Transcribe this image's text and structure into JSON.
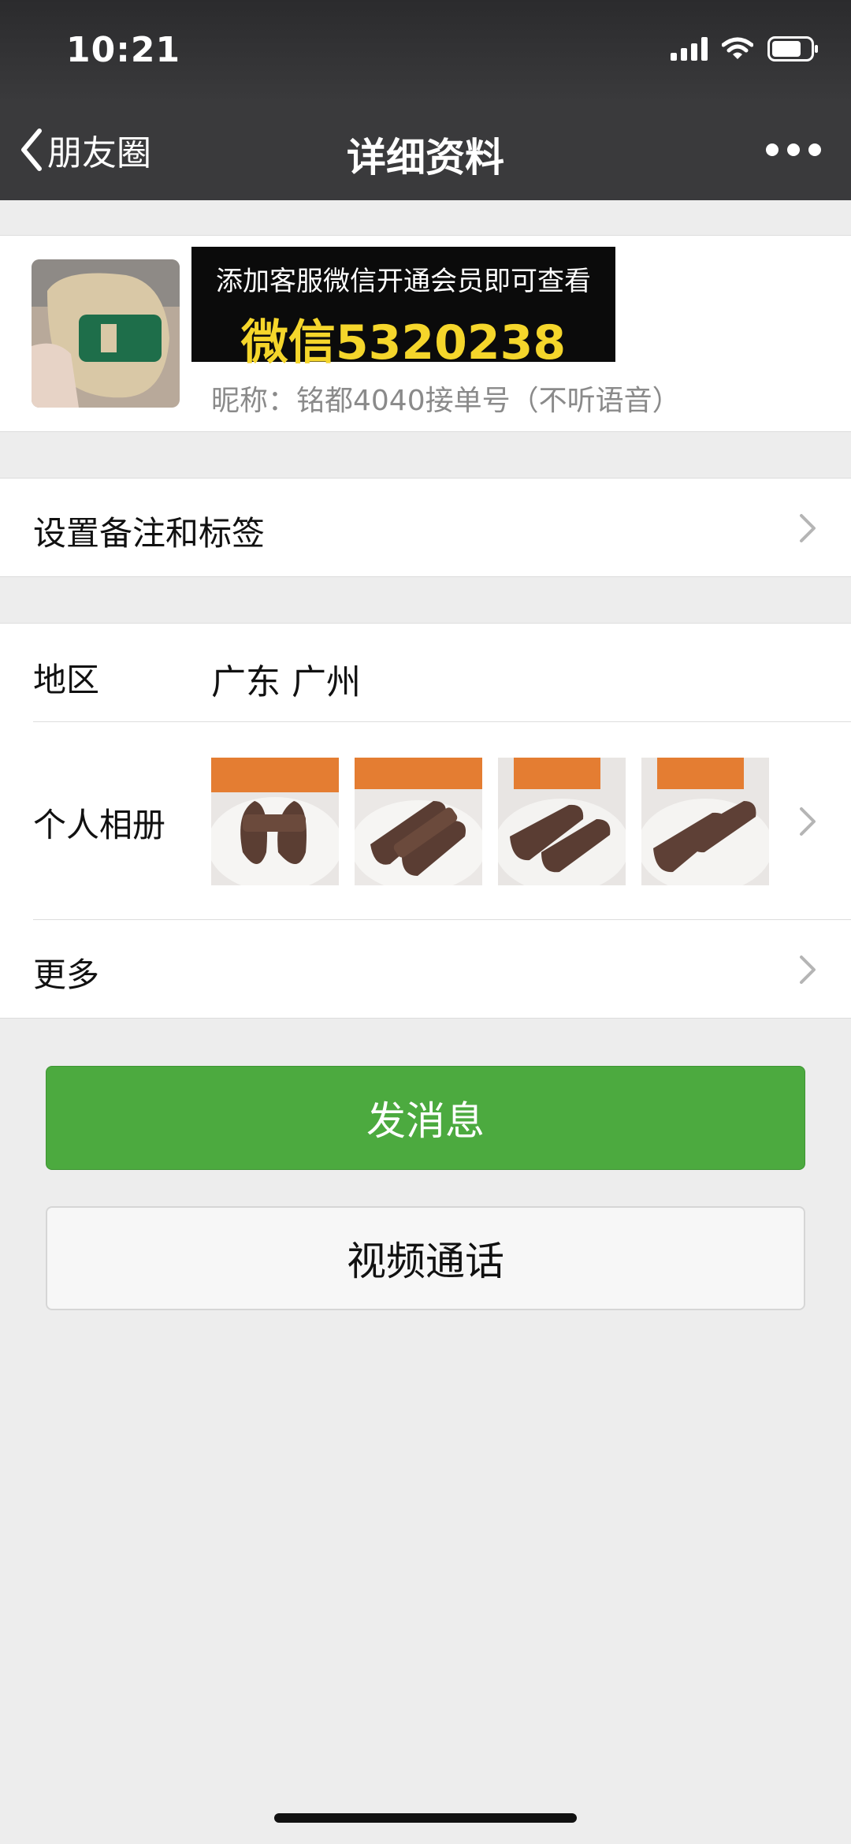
{
  "status_bar": {
    "time": "10:21"
  },
  "nav": {
    "back_label": "朋友圈",
    "title": "详细资料"
  },
  "profile": {
    "banner_line1": "添加客服微信开通会员即可查看",
    "banner_line2": "微信5320238",
    "nickname": "昵称：铭都4040接单号（不听语音）"
  },
  "remark": {
    "label": "设置备注和标签"
  },
  "region": {
    "label": "地区",
    "value": "广东 广州"
  },
  "album": {
    "label": "个人相册"
  },
  "more": {
    "label": "更多"
  },
  "actions": {
    "send_message": "发消息",
    "video_call": "视频通话"
  },
  "colors": {
    "primary_green": "#4CAA3F",
    "nav_bg": "#3a3a3c",
    "page_bg": "#EDEDED",
    "banner_highlight": "#F5D62B"
  },
  "icons": [
    "back-chevron-icon",
    "more-dots-icon",
    "chevron-right-icon",
    "signal-icon",
    "wifi-icon",
    "battery-icon"
  ]
}
